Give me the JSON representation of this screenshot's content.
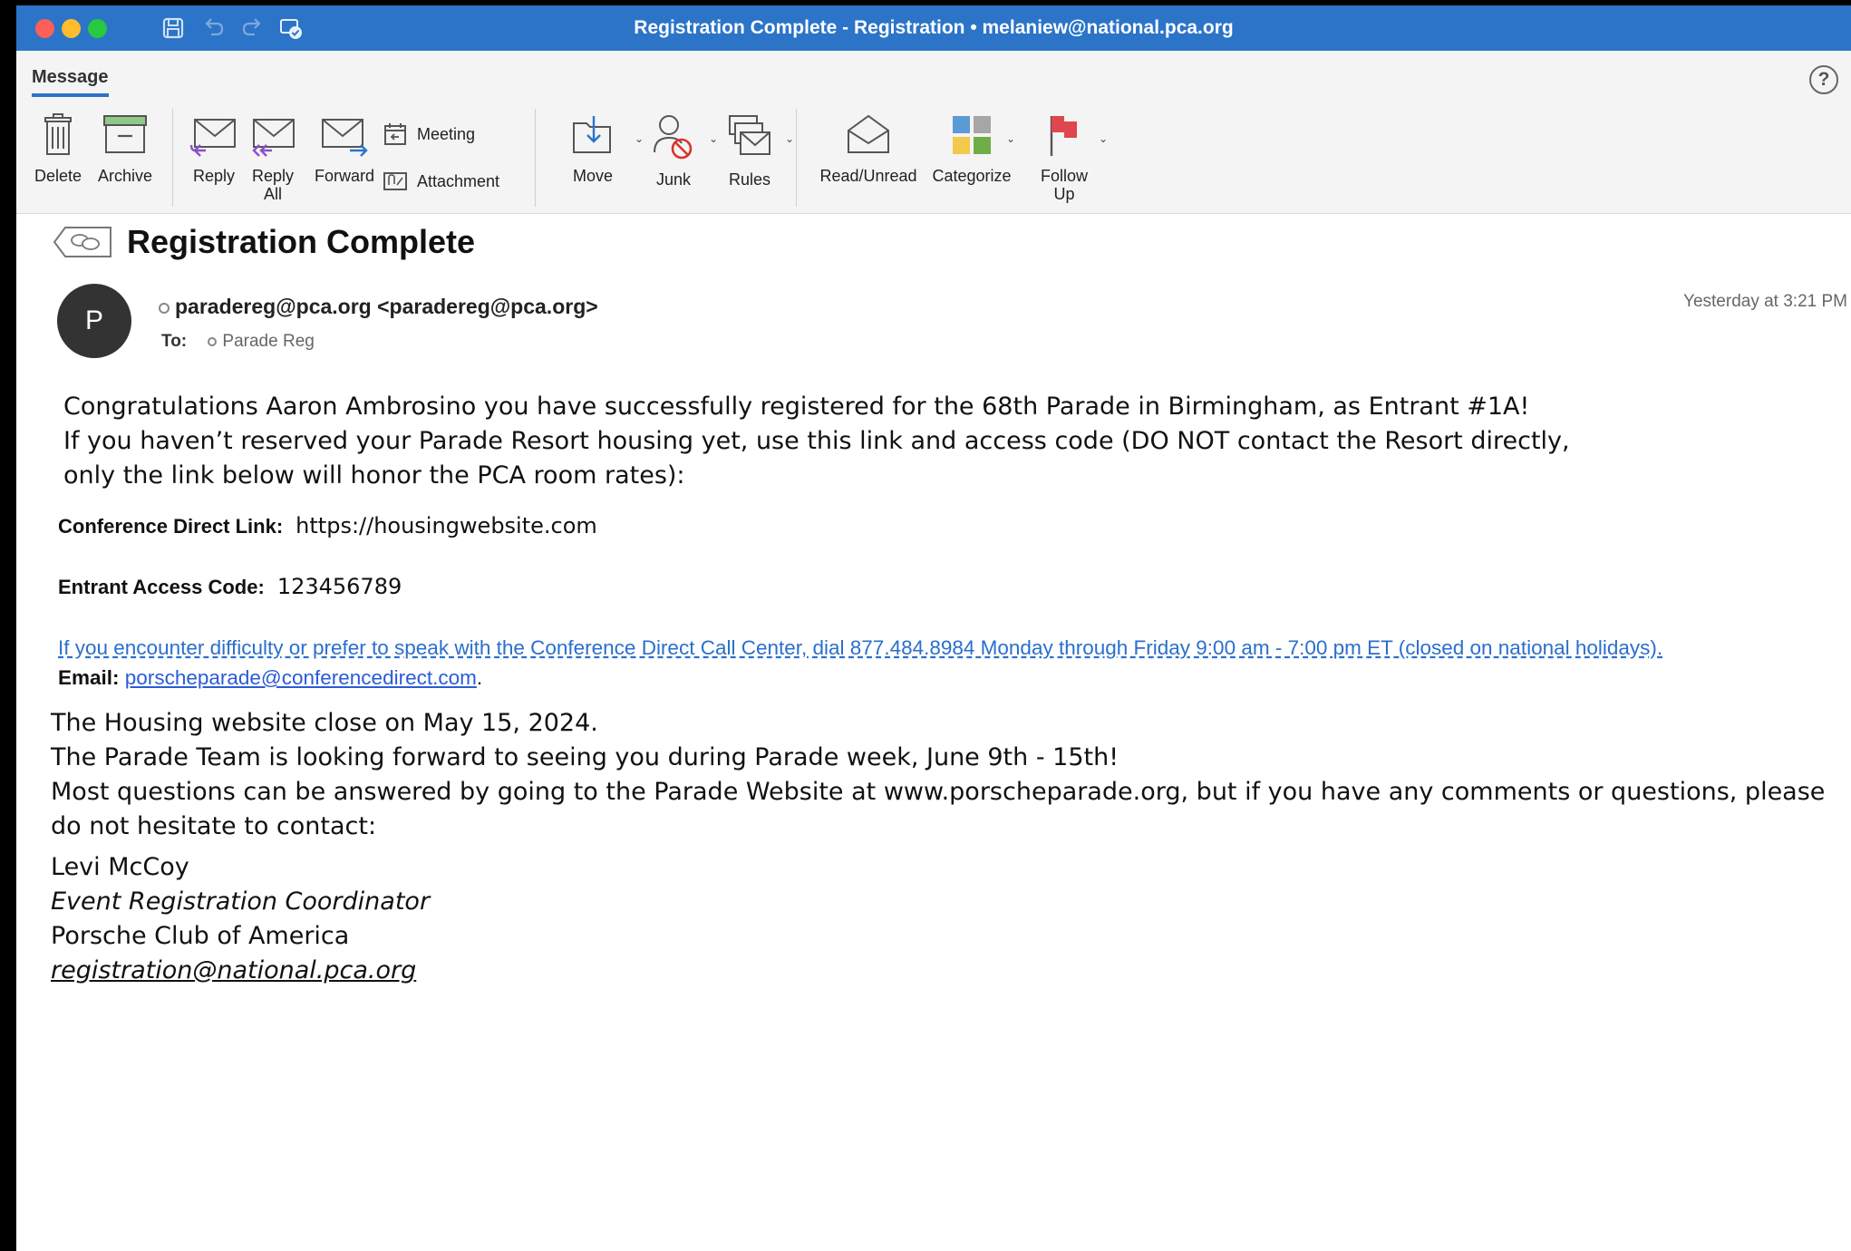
{
  "window": {
    "title": "Registration Complete - Registration • melaniew@national.pca.org"
  },
  "ribbon": {
    "tab": "Message",
    "help": "?",
    "buttons": {
      "delete": "Delete",
      "archive": "Archive",
      "reply": "Reply",
      "reply_all": "Reply All",
      "forward": "Forward",
      "meeting": "Meeting",
      "attachment": "Attachment",
      "move": "Move",
      "junk": "Junk",
      "rules": "Rules",
      "read_unread": "Read/Unread",
      "categorize": "Categorize",
      "follow_up": "Follow Up"
    }
  },
  "message": {
    "subject": "Registration Complete",
    "avatar_initial": "P",
    "from": "paradereg@pca.org <paradereg@pca.org>",
    "to_label": "To:",
    "to": "Parade Reg",
    "timestamp": "Yesterday at 3:21 PM",
    "body": {
      "line1": "Congratulations Aaron Ambrosino you have successfully registered for the 68th Parade in Birmingham, as Entrant #1A!",
      "line2": "If you haven’t reserved your Parade Resort housing yet, use this link and access code (DO NOT contact the Resort directly,",
      "line3": "only the link below will honor the PCA room rates):",
      "link_label": "Conference Direct Link:",
      "link_value": "https://housingwebsite.com",
      "code_label": "Entrant Access Code:",
      "code_value": "123456789",
      "call_center": "If you encounter difficulty or prefer to speak with the Conference Direct Call Center, dial 877.484.8984 Monday through Friday 9:00 am - 7:00 pm ET (closed on national holidays).",
      "email_label": "Email:",
      "email_value": "porscheparade@conferencedirect.com",
      "email_suffix": ".",
      "closing1": "The Housing website close on May 15, 2024.",
      "closing2": "The Parade Team is looking forward to seeing you during Parade week, June 9th - 15th!",
      "closing3": "Most questions can be answered by going to the Parade Website at www.porscheparade.org, but if you have any comments or questions, please do not hesitate to contact:"
    },
    "signature": {
      "name": "Levi McCoy",
      "title": "Event Registration Coordinator",
      "org": "Porsche Club of America",
      "email": "registration@national.pca.org"
    }
  },
  "colors": {
    "titlebar": "#2b74c7",
    "link": "#2a6fcc"
  }
}
